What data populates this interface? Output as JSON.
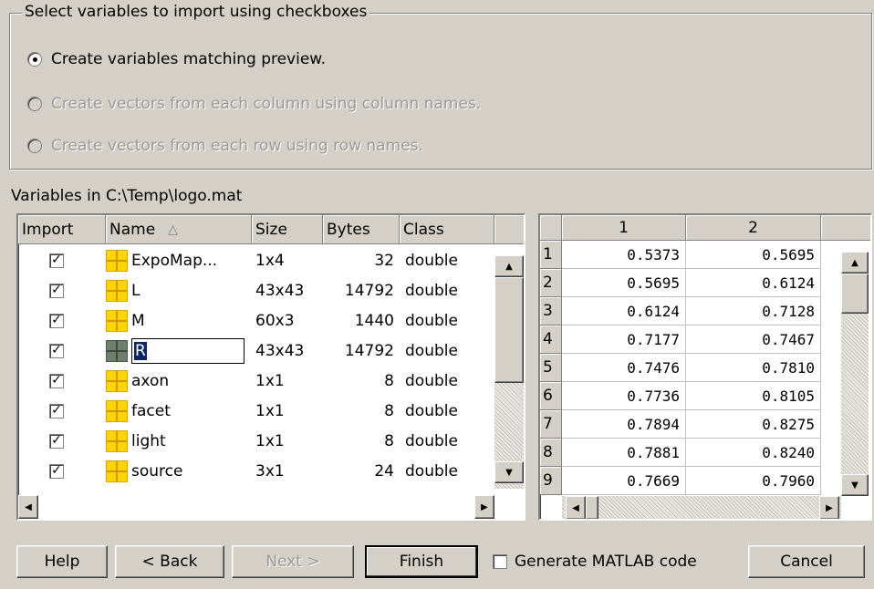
{
  "options": {
    "legend": "Select variables to import using checkboxes",
    "radios": [
      {
        "label": "Create variables matching preview.",
        "selected": true,
        "enabled": true
      },
      {
        "label": "Create vectors from each column using column names.",
        "selected": false,
        "enabled": false
      },
      {
        "label": "Create vectors from each row using row names.",
        "selected": false,
        "enabled": false
      }
    ]
  },
  "variables_label": "Variables in C:\\Temp\\logo.mat",
  "table": {
    "headers": {
      "import": "Import",
      "name": "Name",
      "sort_indicator": "△",
      "size": "Size",
      "bytes": "Bytes",
      "class": "Class"
    },
    "rows": [
      {
        "name": "ExpoMap...",
        "size": "1x4",
        "bytes": "32",
        "class": "double",
        "checked": true,
        "icon": "variable-array-icon"
      },
      {
        "name": "L",
        "size": "43x43",
        "bytes": "14792",
        "class": "double",
        "checked": true,
        "icon": "variable-array-icon"
      },
      {
        "name": "M",
        "size": "60x3",
        "bytes": "1440",
        "class": "double",
        "checked": true,
        "icon": "variable-array-icon"
      },
      {
        "name": "R",
        "size": "43x43",
        "bytes": "14792",
        "class": "double",
        "checked": true,
        "icon": "variable-array-icon",
        "editing": true
      },
      {
        "name": "axon",
        "size": "1x1",
        "bytes": "8",
        "class": "double",
        "checked": true,
        "icon": "variable-array-icon"
      },
      {
        "name": "facet",
        "size": "1x1",
        "bytes": "8",
        "class": "double",
        "checked": true,
        "icon": "variable-array-icon"
      },
      {
        "name": "light",
        "size": "1x1",
        "bytes": "8",
        "class": "double",
        "checked": true,
        "icon": "variable-array-icon"
      },
      {
        "name": "source",
        "size": "3x1",
        "bytes": "24",
        "class": "double",
        "checked": true,
        "icon": "variable-array-icon"
      }
    ]
  },
  "preview": {
    "col_headers": [
      "1",
      "2"
    ],
    "rows": [
      {
        "idx": "1",
        "c1": "0.5373",
        "c2": "0.5695"
      },
      {
        "idx": "2",
        "c1": "0.5695",
        "c2": "0.6124"
      },
      {
        "idx": "3",
        "c1": "0.6124",
        "c2": "0.7128"
      },
      {
        "idx": "4",
        "c1": "0.7177",
        "c2": "0.7467"
      },
      {
        "idx": "5",
        "c1": "0.7476",
        "c2": "0.7810"
      },
      {
        "idx": "6",
        "c1": "0.7736",
        "c2": "0.8105"
      },
      {
        "idx": "7",
        "c1": "0.7894",
        "c2": "0.8275"
      },
      {
        "idx": "8",
        "c1": "0.7881",
        "c2": "0.8240"
      },
      {
        "idx": "9",
        "c1": "0.7669",
        "c2": "0.7960"
      }
    ]
  },
  "buttons": {
    "help": "Help",
    "back": "< Back",
    "next": "Next >",
    "finish": "Finish",
    "generate_code": "Generate MATLAB code",
    "cancel": "Cancel"
  },
  "colors": {
    "face": "#d4d0c8",
    "selection": "#0a246a",
    "var_icon": "#ffd400"
  }
}
